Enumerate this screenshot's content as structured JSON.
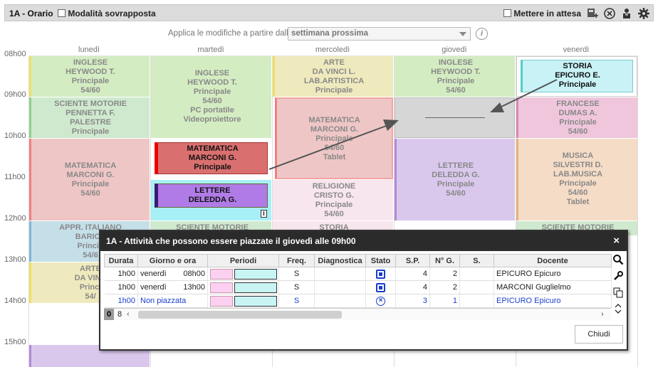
{
  "header": {
    "title": "1A - Orario",
    "overlap_label": "Modalità sovrapposta",
    "waiting_label": "Mettere in attesa"
  },
  "apply": {
    "label": "Applica le modifiche a partire dalla",
    "selected": "settimana prossima"
  },
  "hours": [
    "08h00",
    "09h00",
    "10h00",
    "11h00",
    "12h00",
    "13h00",
    "14h00",
    "15h00"
  ],
  "days": [
    "lunedì",
    "martedì",
    "mercoledì",
    "giovedì",
    "venerdì"
  ],
  "lessons": {
    "mon_1": [
      "INGLESE",
      "HEYWOOD T.",
      "Principale",
      "54/60"
    ],
    "mon_2": [
      "SCIENTE MOTORIE",
      "PENNETTA F.",
      "PALESTRE",
      "Principale"
    ],
    "mon_3": [
      "MATEMATICA",
      "MARCONI G.",
      "Principale",
      "54/60"
    ],
    "mon_4": [
      "APPR. ITALIANO",
      "BARICC",
      "Princip",
      "54/6"
    ],
    "mon_5": [
      "ARTE",
      "DA VINC",
      "Princi",
      "54/"
    ],
    "tue_1": [
      "INGLESE",
      "HEYWOOD T.",
      "Principale",
      "54/60",
      "PC portatile",
      "Videoproiettore"
    ],
    "tue_sel": [
      "MATEMATICA",
      "MARCONI G.",
      "Principale"
    ],
    "tue_let": [
      "LETTERE",
      "DELEDDA G."
    ],
    "tue_3": [
      "SCIENTE MOTORIE"
    ],
    "wed_1": [
      "ARTE",
      "DA VINCI L.",
      "LAB.ARTISTICA",
      "Principale"
    ],
    "wed_2": [
      "MATEMATICA",
      "MARCONI G.",
      "Principale",
      "54/60",
      "Tablet"
    ],
    "wed_3": [
      "RELIGIONE",
      "CRISTO G.",
      "Principale",
      "54/60"
    ],
    "wed_4": [
      "STORIA"
    ],
    "thu_1": [
      "INGLESE",
      "HEYWOOD T.",
      "Principale",
      "54/60"
    ],
    "thu_2": [
      "LETTERE",
      "DELEDDA G.",
      "Principale",
      "54/60"
    ],
    "fri_sel": [
      "STORIA",
      "EPICURO E.",
      "Principale"
    ],
    "fri_1": [
      "FRANCESE",
      "DUMAS A.",
      "Principale",
      "54/60"
    ],
    "fri_2": [
      "MUSICA",
      "SILVESTRI D.",
      "LAB.MUSICA",
      "Principale",
      "54/60",
      "Tablet"
    ],
    "fri_3": [
      "SCIENTE MOTORIE"
    ],
    "lettere_badge": "I"
  },
  "dialog": {
    "title": "1A - Attività che possono essere piazzate il giovedì alle 09h00",
    "close_x": "×",
    "columns": [
      "Durata",
      "Giorno e ora",
      "Periodi",
      "Freq.",
      "Diagnostica",
      "Stato",
      "S.P.",
      "N° G.",
      "S.",
      "Docente"
    ],
    "rows": [
      {
        "durata": "1h00",
        "giorno": "venerdì",
        "ora": "08h00",
        "freq": "S",
        "sp": "4",
        "ng": "2",
        "docente": "EPICURO Epicuro",
        "stato": "placed"
      },
      {
        "durata": "1h00",
        "giorno": "venerdì",
        "ora": "13h00",
        "freq": "S",
        "sp": "4",
        "ng": "2",
        "docente": "MARCONI Guglielmo",
        "stato": "placed"
      },
      {
        "durata": "1h00",
        "giorno": "Non piazzata",
        "ora": "",
        "freq": "S",
        "sp": "3",
        "ng": "1",
        "docente": "EPICURO Epicuro",
        "stato": "unplaced"
      }
    ],
    "count_selected": "0",
    "count_total": "8",
    "close_button": "Chiudi"
  },
  "colors": {
    "inglese": "#d4ecc2",
    "scienze": "#cfe9cf",
    "matematica": "#efc6c6",
    "italiano": "#c5dfe9",
    "arte": "#efeabd",
    "lettere": "#d9c8ec",
    "religione": "#f8e6ee",
    "francese": "#efc6dc",
    "musica": "#f5dcc6",
    "storia_sel": "#c8f2f6",
    "mat_sel": "#d9706f",
    "lettere_sel": "#b07be6"
  }
}
